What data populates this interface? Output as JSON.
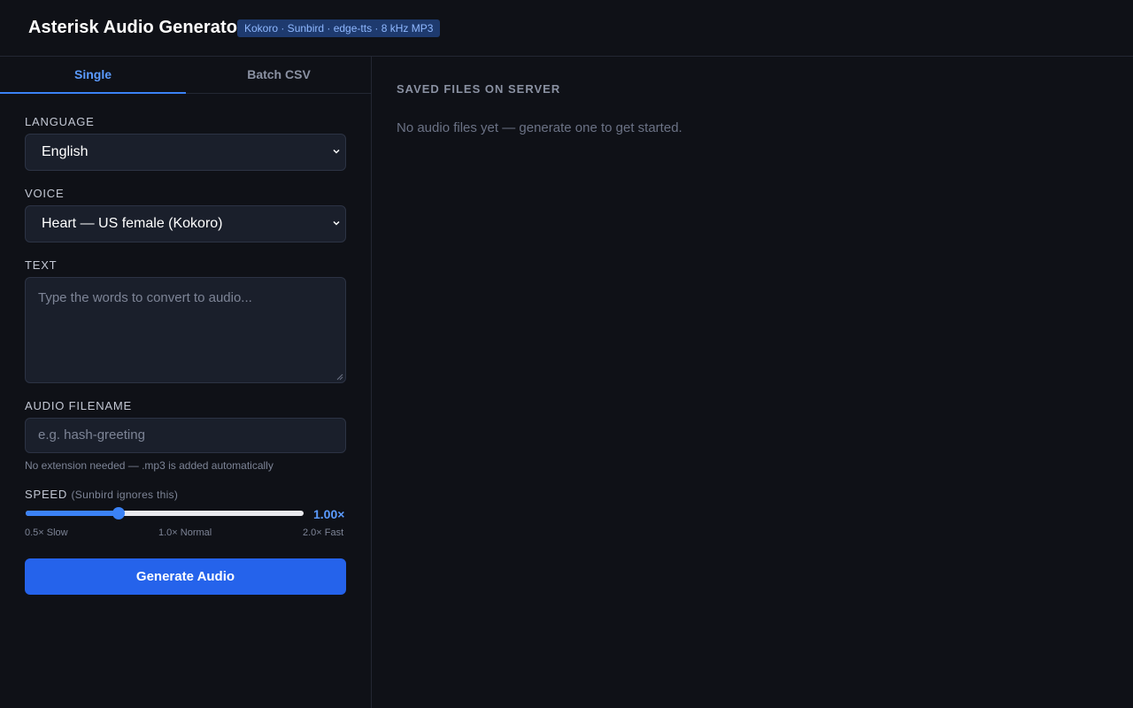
{
  "header": {
    "title": "Asterisk Audio Generator",
    "badge": "Kokoro · Sunbird · edge-tts · 8 kHz MP3"
  },
  "tabs": [
    {
      "label": "Single",
      "active": true
    },
    {
      "label": "Batch CSV",
      "active": false
    }
  ],
  "form": {
    "language": {
      "label": "LANGUAGE",
      "value": "English"
    },
    "voice": {
      "label": "VOICE",
      "value": "Heart — US female (Kokoro)"
    },
    "text": {
      "label": "TEXT",
      "placeholder": "Type the words to convert to audio..."
    },
    "filename": {
      "label": "AUDIO FILENAME",
      "placeholder": "e.g. hash-greeting",
      "hint": "No extension needed — .mp3 is added automatically"
    },
    "speed": {
      "label": "SPEED",
      "sublabel": "(Sunbird ignores this)",
      "value_text": "1.00×",
      "value": 1.0,
      "min": 0.5,
      "max": 2.0,
      "ticks": [
        "0.5× Slow",
        "1.0× Normal",
        "2.0× Fast"
      ]
    },
    "generate_label": "Generate Audio"
  },
  "saved_files": {
    "heading": "SAVED FILES ON SERVER",
    "empty_text": "No audio files yet — generate one to get started."
  },
  "icons": {
    "select_chevron": "chevron-down-icon",
    "resize_handle": "resize-handle-icon"
  },
  "colors": {
    "background": "#0f1117",
    "accent": "#3b82f6",
    "button": "#2563eb",
    "badge_bg": "#1e3a6e",
    "badge_text": "#8fb8ff"
  }
}
